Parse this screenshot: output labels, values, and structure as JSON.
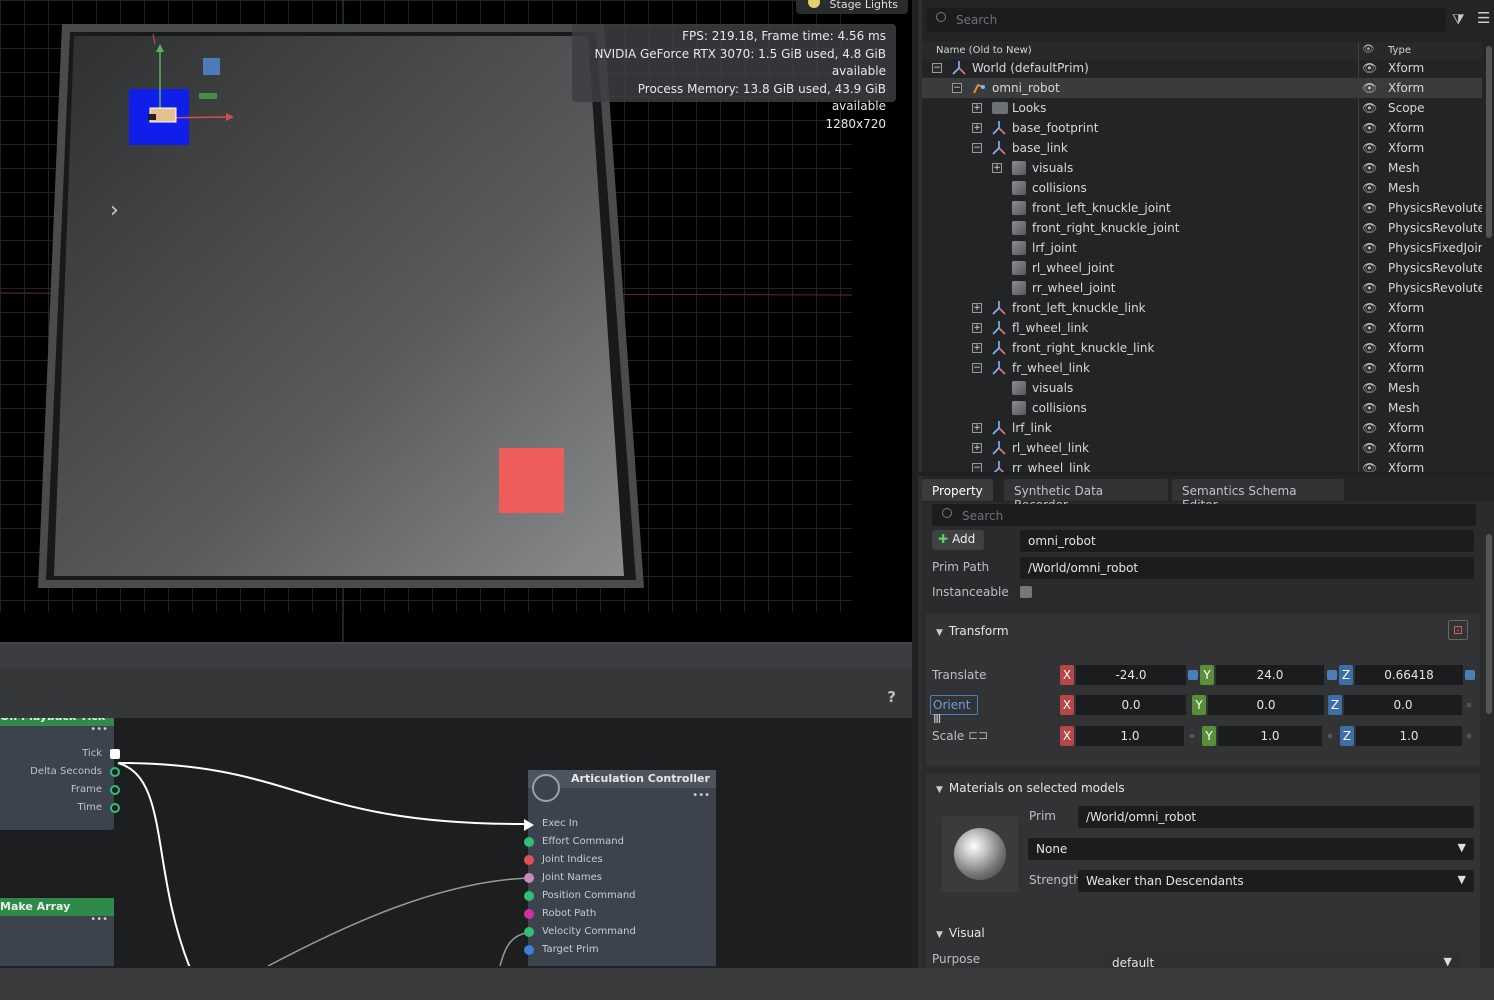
{
  "viewport": {
    "stage_lights_label": "Stage Lights",
    "hud": {
      "fps": "FPS: 219.18, Frame time: 4.56 ms",
      "gpu": "NVIDIA GeForce RTX 3070: 1.5 GiB used, 4.8 GiB available",
      "process_memory": "Process Memory: 13.8 GiB used, 43.9 GiB available",
      "resolution": "1280x720"
    }
  },
  "graph": {
    "help_label": "?",
    "playback_node": {
      "title": "On Playback Tick",
      "outputs": [
        "Tick",
        "Delta Seconds",
        "Frame",
        "Time"
      ]
    },
    "make_array_node": {
      "title": "Make Array"
    },
    "articulation_node": {
      "title": "Articulation Controller",
      "inputs": [
        {
          "label": "Exec In",
          "color": "#ffffff"
        },
        {
          "label": "Effort Command",
          "color": "#2fbf78"
        },
        {
          "label": "Joint Indices",
          "color": "#e0505a"
        },
        {
          "label": "Joint Names",
          "color": "#c88ab8"
        },
        {
          "label": "Position Command",
          "color": "#2fbf78"
        },
        {
          "label": "Robot Path",
          "color": "#d02fa0"
        },
        {
          "label": "Velocity Command",
          "color": "#2fbf78"
        },
        {
          "label": "Target Prim",
          "color": "#3a7fd8"
        }
      ]
    }
  },
  "stage": {
    "search_placeholder": "Search",
    "col_name": "Name (Old to New)",
    "col_type": "Type",
    "rows": [
      {
        "name": "World (defaultPrim)",
        "type": "Xform",
        "indent": 0,
        "expander": "−",
        "icon": "xform-icon"
      },
      {
        "name": "omni_robot",
        "type": "Xform",
        "indent": 1,
        "expander": "−",
        "icon": "robot-icon",
        "selected": true
      },
      {
        "name": "Looks",
        "type": "Scope",
        "indent": 2,
        "expander": "+",
        "icon": "folder-icon"
      },
      {
        "name": "base_footprint",
        "type": "Xform",
        "indent": 2,
        "expander": "+",
        "icon": "xform-icon"
      },
      {
        "name": "base_link",
        "type": "Xform",
        "indent": 2,
        "expander": "−",
        "icon": "xform-icon"
      },
      {
        "name": "visuals",
        "type": "Mesh",
        "indent": 3,
        "expander": "+",
        "icon": "mesh-icon"
      },
      {
        "name": "collisions",
        "type": "Mesh",
        "indent": 3,
        "expander": "",
        "icon": "mesh-icon"
      },
      {
        "name": "front_left_knuckle_joint",
        "type": "PhysicsRevoluteJoint",
        "indent": 3,
        "expander": "",
        "icon": "mesh-icon"
      },
      {
        "name": "front_right_knuckle_joint",
        "type": "PhysicsRevoluteJoint",
        "indent": 3,
        "expander": "",
        "icon": "mesh-icon"
      },
      {
        "name": "lrf_joint",
        "type": "PhysicsFixedJoint",
        "indent": 3,
        "expander": "",
        "icon": "mesh-icon"
      },
      {
        "name": "rl_wheel_joint",
        "type": "PhysicsRevoluteJoint",
        "indent": 3,
        "expander": "",
        "icon": "mesh-icon"
      },
      {
        "name": "rr_wheel_joint",
        "type": "PhysicsRevoluteJoint",
        "indent": 3,
        "expander": "",
        "icon": "mesh-icon"
      },
      {
        "name": "front_left_knuckle_link",
        "type": "Xform",
        "indent": 2,
        "expander": "+",
        "icon": "xform-icon"
      },
      {
        "name": "fl_wheel_link",
        "type": "Xform",
        "indent": 2,
        "expander": "+",
        "icon": "xform-icon"
      },
      {
        "name": "front_right_knuckle_link",
        "type": "Xform",
        "indent": 2,
        "expander": "+",
        "icon": "xform-icon"
      },
      {
        "name": "fr_wheel_link",
        "type": "Xform",
        "indent": 2,
        "expander": "−",
        "icon": "xform-icon"
      },
      {
        "name": "visuals",
        "type": "Mesh",
        "indent": 3,
        "expander": "",
        "icon": "mesh-icon"
      },
      {
        "name": "collisions",
        "type": "Mesh",
        "indent": 3,
        "expander": "",
        "icon": "mesh-icon"
      },
      {
        "name": "lrf_link",
        "type": "Xform",
        "indent": 2,
        "expander": "+",
        "icon": "xform-icon"
      },
      {
        "name": "rl_wheel_link",
        "type": "Xform",
        "indent": 2,
        "expander": "+",
        "icon": "xform-icon"
      },
      {
        "name": "rr_wheel_link",
        "type": "Xform",
        "indent": 2,
        "expander": "−",
        "icon": "xform-icon"
      }
    ]
  },
  "property": {
    "tabs": [
      "Property",
      "Synthetic Data Recorder",
      "Semantics Schema Editor"
    ],
    "search_placeholder": "Search",
    "add_label": "Add",
    "prim_name": "omni_robot",
    "prim_path_label": "Prim Path",
    "prim_path": "/World/omni_robot",
    "instanceable_label": "Instanceable",
    "transform": {
      "title": "Transform",
      "translate_label": "Translate",
      "translate": [
        "-24.0",
        "24.0",
        "0.66418"
      ],
      "orient_label": "Orient",
      "orient": [
        "0.0",
        "0.0",
        "0.0"
      ],
      "scale_label": "Scale",
      "scale": [
        "1.0",
        "1.0",
        "1.0"
      ]
    },
    "materials": {
      "title": "Materials on selected models",
      "prim_label": "Prim",
      "prim_value": "/World/omni_robot",
      "material_value": "None",
      "strength_label": "Strength",
      "strength_value": "Weaker than Descendants"
    },
    "visual": {
      "title": "Visual",
      "purpose_label": "Purpose",
      "purpose_value": "default"
    }
  }
}
